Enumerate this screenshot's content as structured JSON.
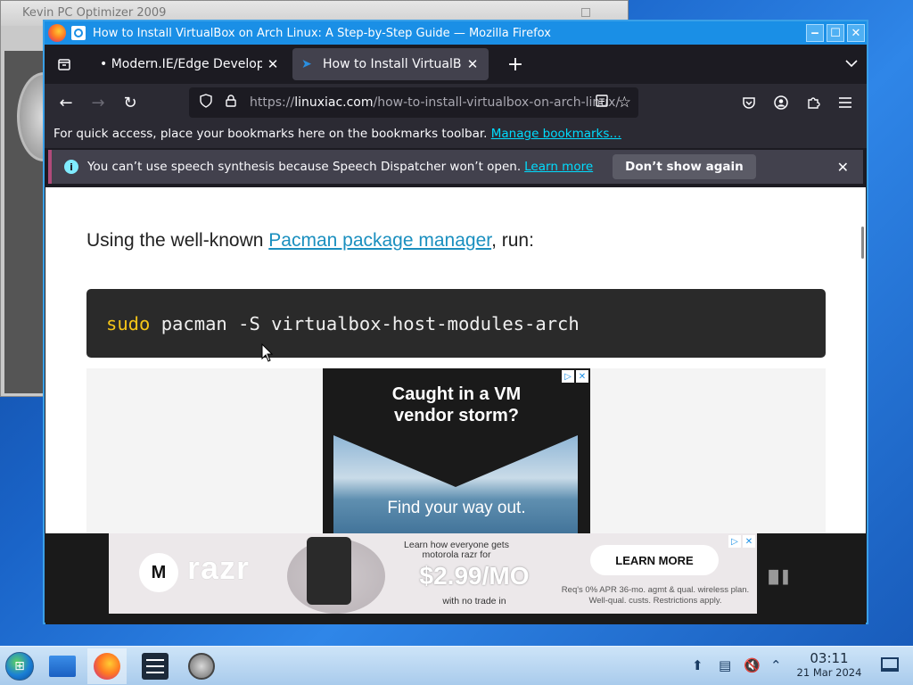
{
  "background_window": {
    "title": "Kevin PC Optimizer 2009"
  },
  "window": {
    "title": "How to Install VirtualBox on Arch Linux: A Step-by-Step Guide — Mozilla Firefox",
    "controls": [
      "minimize",
      "maximize",
      "close"
    ]
  },
  "tabs": [
    {
      "label": "• Modern.IE/Edge Developer",
      "active": false
    },
    {
      "label": "How to Install VirtualBox",
      "active": true
    }
  ],
  "toolbar": {
    "url_scheme": "https://",
    "url_host": "linuxiac.com",
    "url_path": "/how-to-install-virtualbox-on-arch-linux/"
  },
  "bookmarks_bar": {
    "text": "For quick access, place your bookmarks here on the bookmarks toolbar.",
    "link": "Manage bookmarks…"
  },
  "notification": {
    "message": "You can’t use speech synthesis because Speech Dispatcher won’t open.",
    "link": "Learn more",
    "button": "Don’t show again"
  },
  "page": {
    "para_before": "Using the well-known ",
    "para_link": "Pacman package manager",
    "para_after": ", run:",
    "code_keyword": "sudo",
    "code_rest": " pacman -S virtualbox-host-modules-arch"
  },
  "ad_vm": {
    "headline_line1": "Caught in a VM",
    "headline_line2": "vendor storm?",
    "tagline": "Find your way out."
  },
  "ad_razr": {
    "brand": "razr",
    "learn_line": "Learn how everyone gets motorola razr for",
    "price": "$2.99/MO",
    "no_trade": "with no trade in",
    "cta": "LEARN MORE",
    "fine_print": "Req's 0% APR 36-mo. agmt & qual. wireless plan. Well-qual. custs. Restrictions apply."
  },
  "taskbar": {
    "time": "03:11",
    "date": "21 Mar 2024"
  }
}
